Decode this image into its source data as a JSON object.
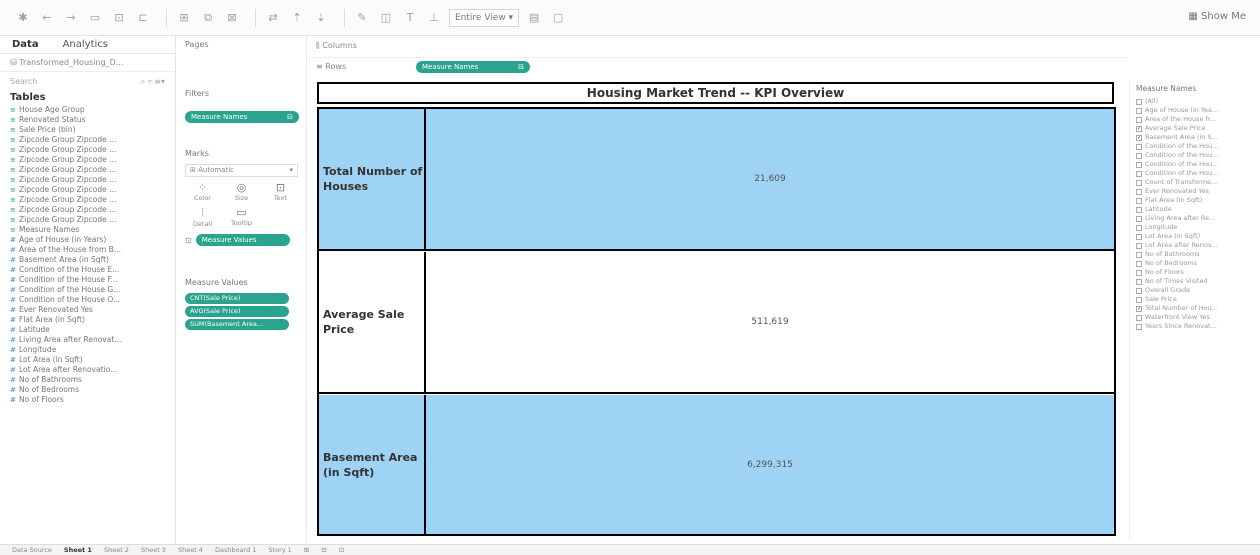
{
  "toolbar": {
    "view_select": "Entire View",
    "show_me": "Show Me"
  },
  "data_pane": {
    "tabs": [
      "Data",
      "Analytics"
    ],
    "source": "Transformed_Housing_D...",
    "search_placeholder": "Search",
    "tables_title": "Tables",
    "fields": [
      {
        "type": "dim",
        "name": "House Age Group"
      },
      {
        "type": "dim",
        "name": "Renovated Status"
      },
      {
        "type": "dim",
        "name": "Sale Price (bin)"
      },
      {
        "type": "dim",
        "name": "Zipcode Group Zipcode ..."
      },
      {
        "type": "dim",
        "name": "Zipcode Group Zipcode ..."
      },
      {
        "type": "dim",
        "name": "Zipcode Group Zipcode ..."
      },
      {
        "type": "dim",
        "name": "Zipcode Group Zipcode ..."
      },
      {
        "type": "dim",
        "name": "Zipcode Group Zipcode ..."
      },
      {
        "type": "dim",
        "name": "Zipcode Group Zipcode ..."
      },
      {
        "type": "dim",
        "name": "Zipcode Group Zipcode ..."
      },
      {
        "type": "dim",
        "name": "Zipcode Group Zipcode ..."
      },
      {
        "type": "dim",
        "name": "Zipcode Group Zipcode ..."
      },
      {
        "type": "dim",
        "name": "Measure Names"
      },
      {
        "type": "mea",
        "name": "Age of House (in Years)"
      },
      {
        "type": "mea",
        "name": "Area of the House from B..."
      },
      {
        "type": "mea",
        "name": "Basement Area (in Sqft)"
      },
      {
        "type": "mea",
        "name": "Condition of the House E..."
      },
      {
        "type": "mea",
        "name": "Condition of the House F..."
      },
      {
        "type": "mea",
        "name": "Condition of the House G..."
      },
      {
        "type": "mea",
        "name": "Condition of the House O..."
      },
      {
        "type": "mea",
        "name": "Ever Renovated Yes"
      },
      {
        "type": "mea",
        "name": "Flat Area (in Sqft)"
      },
      {
        "type": "mea",
        "name": "Latitude"
      },
      {
        "type": "mea",
        "name": "Living Area after Renovat..."
      },
      {
        "type": "mea",
        "name": "Longitude"
      },
      {
        "type": "mea",
        "name": "Lot Area (in Sqft)"
      },
      {
        "type": "mea",
        "name": "Lot Area after Renovatio..."
      },
      {
        "type": "mea",
        "name": "No of Bathrooms"
      },
      {
        "type": "mea",
        "name": "No of Bedrooms"
      },
      {
        "type": "mea",
        "name": "No of Floors"
      }
    ]
  },
  "mid_pane": {
    "pages_title": "Pages",
    "filters_title": "Filters",
    "filter_pill": "Measure Names",
    "marks_title": "Marks",
    "marks_type": "Automatic",
    "marks_cells": [
      {
        "icon": "color",
        "label": "Color"
      },
      {
        "icon": "size",
        "label": "Size"
      },
      {
        "icon": "text",
        "label": "Text"
      },
      {
        "icon": "detail",
        "label": "Detail"
      },
      {
        "icon": "tooltip",
        "label": "Tooltip"
      }
    ],
    "marks_pill": "Measure Values",
    "measure_values_title": "Measure Values",
    "measure_values": [
      "CNT(Sale Price)",
      "AVG(Sale Price)",
      "SUM(Basement Area..."
    ]
  },
  "shelves": {
    "columns_label": "Columns",
    "rows_label": "Rows",
    "rows_pill": "Measure Names"
  },
  "view": {
    "title": "Housing Market Trend -- KPI Overview",
    "rows": [
      {
        "label": "Total Number of Houses",
        "value": "21,609"
      },
      {
        "label": "Average Sale Price",
        "value": "511,619"
      },
      {
        "label": "Basement Area (in Sqft)",
        "value": "6,299,315"
      }
    ]
  },
  "legend": {
    "title": "Measure Names",
    "items": [
      {
        "checked": false,
        "label": "(All)"
      },
      {
        "checked": false,
        "label": "Age of House (in Yea..."
      },
      {
        "checked": false,
        "label": "Area of the House fr..."
      },
      {
        "checked": true,
        "label": "Average Sale Price"
      },
      {
        "checked": true,
        "label": "Basement Area (in S..."
      },
      {
        "checked": false,
        "label": "Condition of the Hou..."
      },
      {
        "checked": false,
        "label": "Condition of the Hou..."
      },
      {
        "checked": false,
        "label": "Condition of the Hou..."
      },
      {
        "checked": false,
        "label": "Condition of the Hou..."
      },
      {
        "checked": false,
        "label": "Count of Transforme..."
      },
      {
        "checked": false,
        "label": "Ever Renovated Yes"
      },
      {
        "checked": false,
        "label": "Flat Area (in Sqft)"
      },
      {
        "checked": false,
        "label": "Latitude"
      },
      {
        "checked": false,
        "label": "Living Area after Re..."
      },
      {
        "checked": false,
        "label": "Longitude"
      },
      {
        "checked": false,
        "label": "Lot Area (in Sqft)"
      },
      {
        "checked": false,
        "label": "Lot Area after Renov..."
      },
      {
        "checked": false,
        "label": "No of Bathrooms"
      },
      {
        "checked": false,
        "label": "No of Bedrooms"
      },
      {
        "checked": false,
        "label": "No of Floors"
      },
      {
        "checked": false,
        "label": "No of Times Visited"
      },
      {
        "checked": false,
        "label": "Overall Grade"
      },
      {
        "checked": false,
        "label": "Sale Price"
      },
      {
        "checked": true,
        "label": "Total Number of Hou..."
      },
      {
        "checked": false,
        "label": "Waterfront View Yes"
      },
      {
        "checked": false,
        "label": "Years Since Renovat..."
      }
    ]
  },
  "statusbar": {
    "tabs": [
      "Data Source",
      "Sheet 1",
      "Sheet 2",
      "Sheet 3",
      "Sheet 4",
      "Dashboard 1",
      "Story 1"
    ]
  }
}
